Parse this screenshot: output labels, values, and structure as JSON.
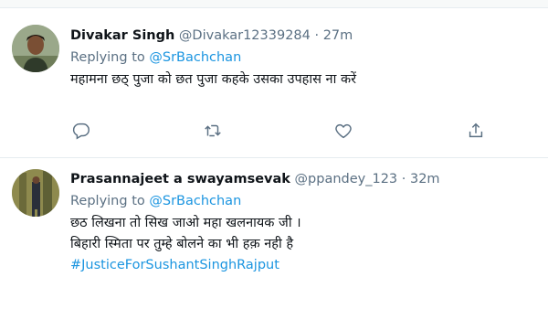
{
  "tweets": [
    {
      "name": "Divakar Singh",
      "handle": "@Divakar12339284",
      "time": "· 27m",
      "replying_prefix": "Replying to ",
      "replying_to": "@SrBachchan",
      "lines": [
        "महामना छठ् पुजा को छत पुजा कहके उसका उपहास ना करें"
      ],
      "actions": [
        "reply-icon",
        "retweet-icon",
        "like-icon",
        "share-icon"
      ]
    },
    {
      "name": "Prasannajeet a swayamsevak",
      "handle": "@ppandey_123",
      "time": "· 32m",
      "replying_prefix": "Replying to ",
      "replying_to": "@SrBachchan",
      "lines": [
        "छठ लिखना तो सिख जाओ महा खलनायक जी ।",
        "बिहारी स्मिता पर तुम्हे बोलने का भी हक़ नही है"
      ],
      "hashtag": "#JusticeForSushantSinghRajput"
    }
  ],
  "colors": {
    "link": "#1b95e0",
    "muted": "#5b7083",
    "text": "#0f1419",
    "border": "#e6ecf0"
  }
}
